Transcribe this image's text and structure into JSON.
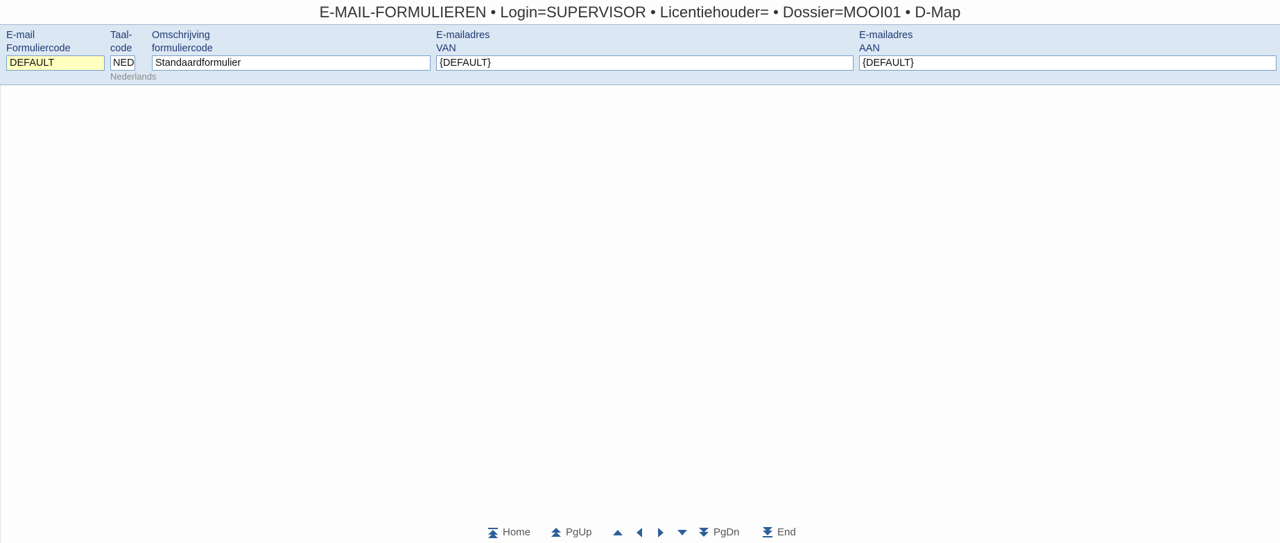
{
  "header": {
    "title": "E-MAIL-FORMULIEREN  •  Login=SUPERVISOR  •  Licentiehouder=  •  Dossier=MOOI01  •  D-Map"
  },
  "form": {
    "code_label_1": "E-mail",
    "code_label_2": "Formuliercode",
    "code_value": "DEFAULT",
    "lang_label_1": "Taal-",
    "lang_label_2": "code",
    "lang_value": "NED",
    "lang_desc": "Nederlands",
    "desc_label_1": "Omschrijving",
    "desc_label_2": "formuliercode",
    "desc_value": "Standaardformulier",
    "from_label_1": "E-mailadres",
    "from_label_2": "VAN",
    "from_value": "{DEFAULT}",
    "to_label_1": "E-mailadres",
    "to_label_2": "AAN",
    "to_value": "{DEFAULT}"
  },
  "nav": {
    "home": "Home",
    "pgup": "PgUp",
    "pgdn": "PgDn",
    "end": "End"
  }
}
